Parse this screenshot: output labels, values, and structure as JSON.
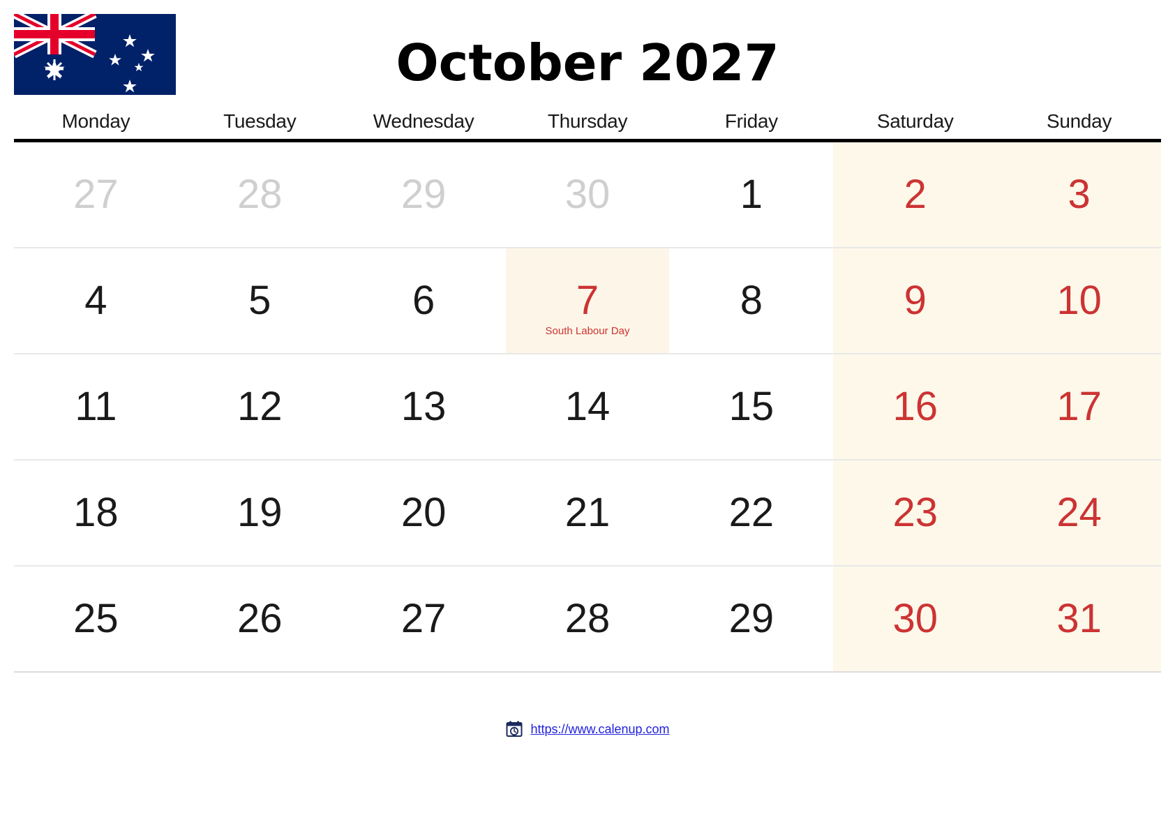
{
  "header": {
    "title": "October 2027",
    "flag_alt": "australia-flag"
  },
  "colors": {
    "weekend_text": "#cc3333",
    "weekend_bg": "#fdf8ea",
    "holiday_text": "#cc3333",
    "other_month_text": "#cfcfcf",
    "rule": "#000000",
    "link": "#2222dd",
    "flag_navy": "#012169",
    "flag_red": "#e4002b",
    "flag_white": "#ffffff"
  },
  "weekdays": [
    "Monday",
    "Tuesday",
    "Wednesday",
    "Thursday",
    "Friday",
    "Saturday",
    "Sunday"
  ],
  "weeks": [
    [
      {
        "num": "27",
        "type": "other"
      },
      {
        "num": "28",
        "type": "other"
      },
      {
        "num": "29",
        "type": "other"
      },
      {
        "num": "30",
        "type": "other"
      },
      {
        "num": "1",
        "type": "normal"
      },
      {
        "num": "2",
        "type": "weekend"
      },
      {
        "num": "3",
        "type": "weekend"
      }
    ],
    [
      {
        "num": "4",
        "type": "normal"
      },
      {
        "num": "5",
        "type": "normal"
      },
      {
        "num": "6",
        "type": "normal"
      },
      {
        "num": "7",
        "type": "holiday",
        "label": "South Labour Day"
      },
      {
        "num": "8",
        "type": "normal"
      },
      {
        "num": "9",
        "type": "weekend"
      },
      {
        "num": "10",
        "type": "weekend"
      }
    ],
    [
      {
        "num": "11",
        "type": "normal"
      },
      {
        "num": "12",
        "type": "normal"
      },
      {
        "num": "13",
        "type": "normal"
      },
      {
        "num": "14",
        "type": "normal"
      },
      {
        "num": "15",
        "type": "normal"
      },
      {
        "num": "16",
        "type": "weekend"
      },
      {
        "num": "17",
        "type": "weekend"
      }
    ],
    [
      {
        "num": "18",
        "type": "normal"
      },
      {
        "num": "19",
        "type": "normal"
      },
      {
        "num": "20",
        "type": "normal"
      },
      {
        "num": "21",
        "type": "normal"
      },
      {
        "num": "22",
        "type": "normal"
      },
      {
        "num": "23",
        "type": "weekend"
      },
      {
        "num": "24",
        "type": "weekend"
      }
    ],
    [
      {
        "num": "25",
        "type": "normal"
      },
      {
        "num": "26",
        "type": "normal"
      },
      {
        "num": "27",
        "type": "normal"
      },
      {
        "num": "28",
        "type": "normal"
      },
      {
        "num": "29",
        "type": "normal"
      },
      {
        "num": "30",
        "type": "weekend"
      },
      {
        "num": "31",
        "type": "weekend"
      }
    ]
  ],
  "footer": {
    "icon": "calendar-clock-icon",
    "url": "https://www.calenup.com"
  }
}
